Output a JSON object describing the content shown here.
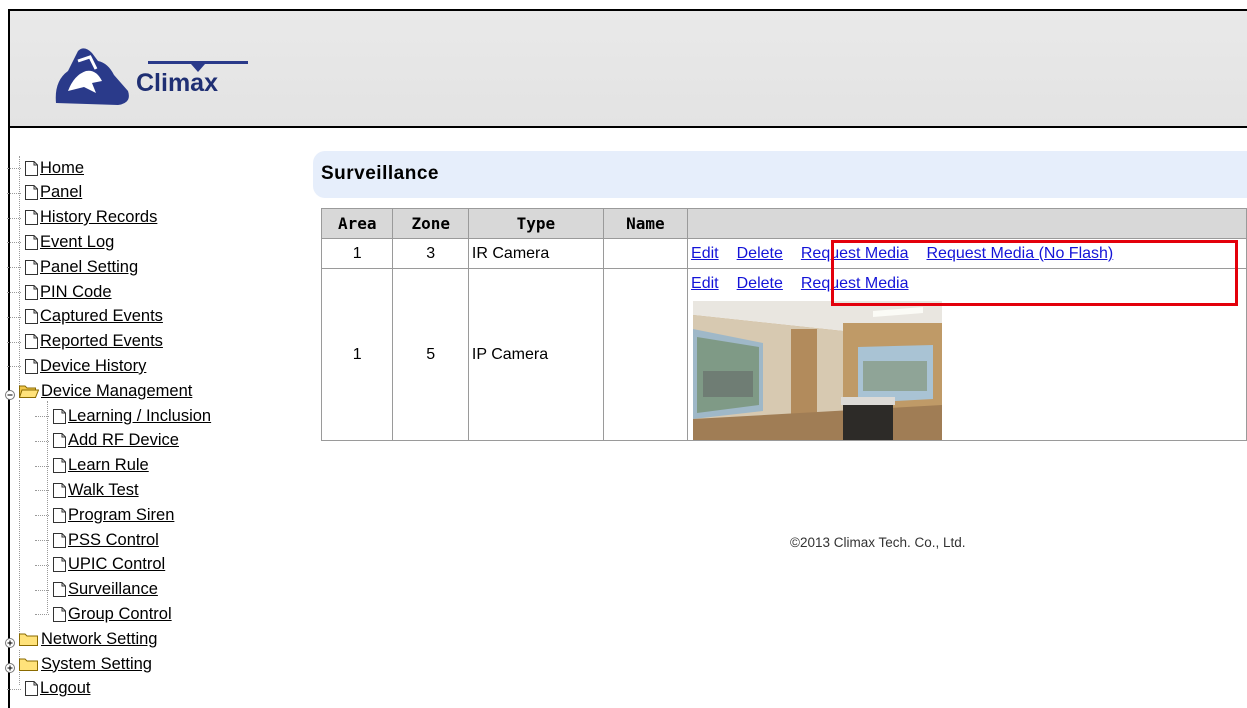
{
  "brand": {
    "name": "Climax"
  },
  "sidebar": {
    "items": [
      {
        "label": "Home"
      },
      {
        "label": "Panel"
      },
      {
        "label": "History Records"
      },
      {
        "label": "Event Log"
      },
      {
        "label": "Panel Setting"
      },
      {
        "label": "PIN Code"
      },
      {
        "label": "Captured Events"
      },
      {
        "label": "Reported Events"
      },
      {
        "label": "Device History"
      },
      {
        "label": "Device Management",
        "expanded": true,
        "children": [
          {
            "label": "Learning / Inclusion"
          },
          {
            "label": "Add RF Device"
          },
          {
            "label": "Learn Rule"
          },
          {
            "label": "Walk Test"
          },
          {
            "label": "Program Siren"
          },
          {
            "label": "PSS Control"
          },
          {
            "label": "UPIC Control"
          },
          {
            "label": "Surveillance"
          },
          {
            "label": "Group Control"
          }
        ]
      },
      {
        "label": "Network Setting",
        "expanded": false
      },
      {
        "label": "System Setting",
        "expanded": false
      },
      {
        "label": "Logout"
      }
    ]
  },
  "main": {
    "title": "Surveillance",
    "table": {
      "headers": [
        "Area",
        "Zone",
        "Type",
        "Name",
        ""
      ],
      "rows": [
        {
          "area": "1",
          "zone": "3",
          "type": "IR Camera",
          "name": "",
          "actions": [
            "Edit",
            "Delete",
            "Request Media",
            "Request Media (No Flash)"
          ]
        },
        {
          "area": "1",
          "zone": "5",
          "type": "IP Camera",
          "name": "",
          "actions": [
            "Edit",
            "Delete",
            "Request Media"
          ],
          "has_snapshot": true
        }
      ]
    }
  },
  "footer": {
    "copyright": "©2013 Climax Tech. Co., Ltd."
  },
  "colors": {
    "link": "#1414d8",
    "highlight": "#e3000b",
    "title_bg": "#e6eefb",
    "header_bg": "#e6e6e6"
  }
}
